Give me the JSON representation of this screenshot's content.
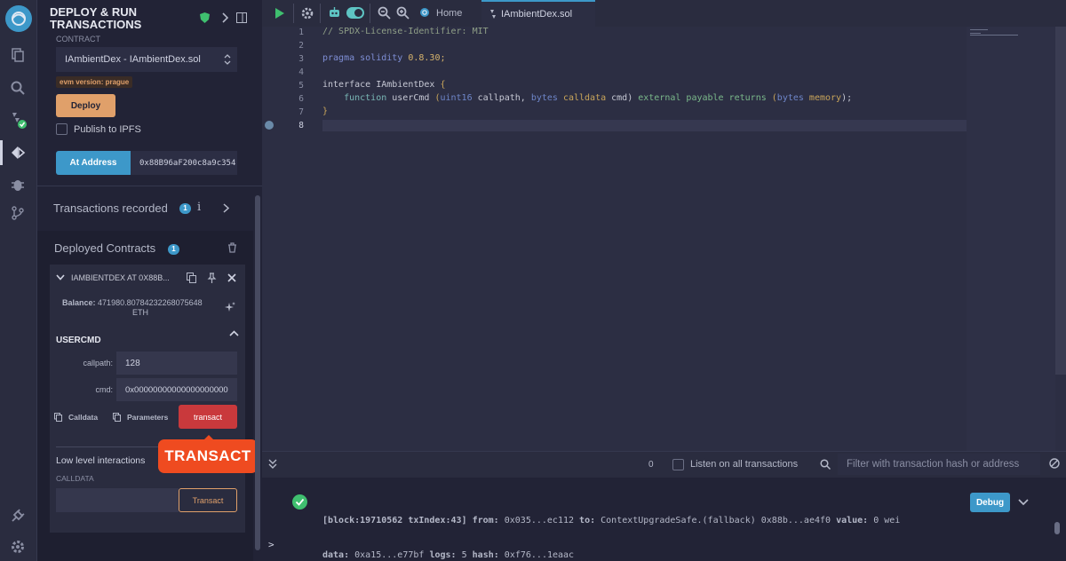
{
  "plugin": {
    "title_line1": "DEPLOY & RUN",
    "title_line2": "TRANSACTIONS",
    "contract_label": "CONTRACT",
    "contract_selected": "IAmbientDex - IAmbientDex.sol",
    "evm_badge": "evm version: prague",
    "deploy_label": "Deploy",
    "publish_ipfs_label": "Publish to IPFS",
    "at_address_label": "At Address",
    "at_address_value": "0x88B96aF200c8a9c354"
  },
  "transactions_recorded": {
    "label": "Transactions recorded",
    "count": "1",
    "info": "i"
  },
  "deployed": {
    "title": "Deployed Contracts",
    "count": "1",
    "instance_title": "IAMBIENTDEX AT 0X88B...",
    "balance_label": "Balance:",
    "balance_value": "471980.807842322680756 48",
    "balance_line1": "471980.80784232268075648",
    "balance_line2": "ETH",
    "function_name": "USERCMD",
    "params": [
      {
        "label": "callpath:",
        "value": "128"
      },
      {
        "label": "cmd:",
        "value": "0x00000000000000000000"
      }
    ],
    "calldata_label": "Calldata",
    "parameters_label": "Parameters",
    "transact_label": "transact",
    "callout_label": "TRANSACT",
    "low_level_title": "Low level interactions",
    "calldata_field_label": "CALLDATA",
    "low_level_transact": "Transact"
  },
  "tabs": [
    {
      "label": "Home"
    },
    {
      "label": "IAmbientDex.sol"
    }
  ],
  "code_lines": [
    {
      "n": "1"
    },
    {
      "n": "2"
    },
    {
      "n": "3"
    },
    {
      "n": "4"
    },
    {
      "n": "5"
    },
    {
      "n": "6"
    },
    {
      "n": "7"
    },
    {
      "n": "8"
    }
  ],
  "code": {
    "l1": "// SPDX-License-Identifier: MIT",
    "l3_kw": "pragma solidity",
    "l3_ver": "0.8.30;",
    "l5_kw": "interface",
    "l5_name": " IAmbientDex ",
    "l5_brace": "{",
    "l6_fn": "    function",
    "l6_name": " userCmd ",
    "l6_p1": "(",
    "l6_t1": "uint16",
    "l6_a1": " callpath, ",
    "l6_t2": "bytes",
    "l6_m2": " calldata",
    "l6_a2": " cmd) ",
    "l6_vis": "external payable",
    "l6_ret": " returns ",
    "l6_p2": "(",
    "l6_t3": "bytes",
    "l6_m3": " memory",
    "l6_end": ");",
    "l7": "}"
  },
  "terminal": {
    "pending_count": "0",
    "listen_label": "Listen on all transactions",
    "filter_placeholder": "Filter with transaction hash or address",
    "log_line1": "[block:19710562 txIndex:43]",
    "log_from_label": "from:",
    "log_from": "0x035...ec112",
    "log_to_label": "to:",
    "log_to": "ContextUpgradeSafe.(fallback) 0x88b...ae4f0",
    "log_value_label": "value:",
    "log_value": "0 wei",
    "log_data_label": "data:",
    "log_data": "0xa15...e77bf",
    "log_logs_label": "logs:",
    "log_logs": "5",
    "log_hash_label": "hash:",
    "log_hash": "0xf76...1eaac",
    "debug_label": "Debug",
    "prompt": ">"
  },
  "colors": {
    "accent_blue": "#3d98c9",
    "deploy_orange": "#e0a06a",
    "transact_red": "#c9393c",
    "success_green": "#3fbf6f"
  }
}
